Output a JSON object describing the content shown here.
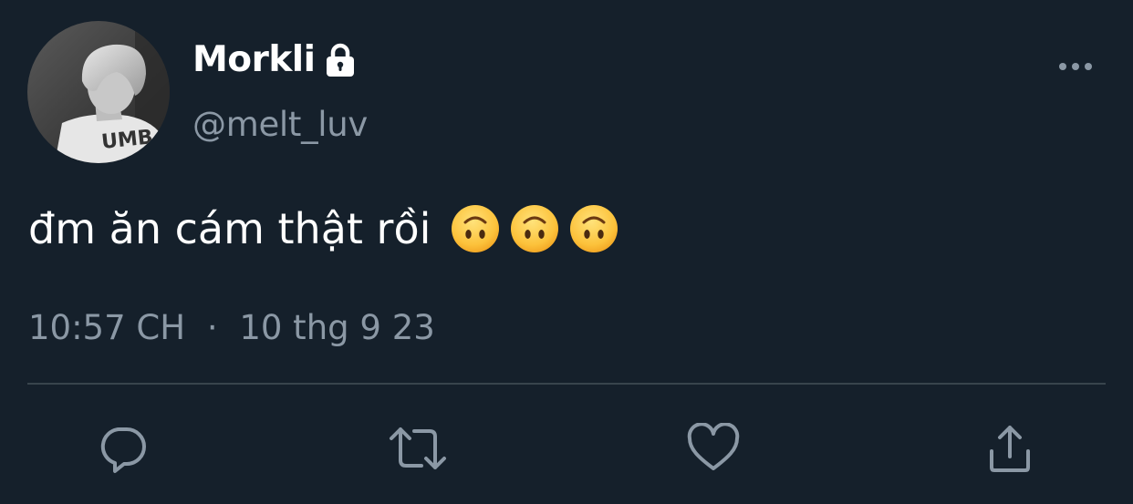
{
  "user": {
    "display_name": "Morkli",
    "handle": "@melt_luv",
    "protected": true,
    "avatar_icon": "profile-photo"
  },
  "tweet": {
    "text": "đm ăn cám thật rồi",
    "emojis": [
      "upside-down-face",
      "upside-down-face",
      "upside-down-face"
    ],
    "time": "10:57 CH",
    "separator": "·",
    "date": "10 thg 9 23"
  },
  "actions": {
    "reply_icon": "reply-icon",
    "retweet_icon": "retweet-icon",
    "like_icon": "like-icon",
    "share_icon": "share-icon",
    "more_icon": "more-icon"
  },
  "colors": {
    "background": "#15202b",
    "primary_text": "#ffffff",
    "secondary_text": "#8b98a5",
    "divider": "#38444d"
  }
}
